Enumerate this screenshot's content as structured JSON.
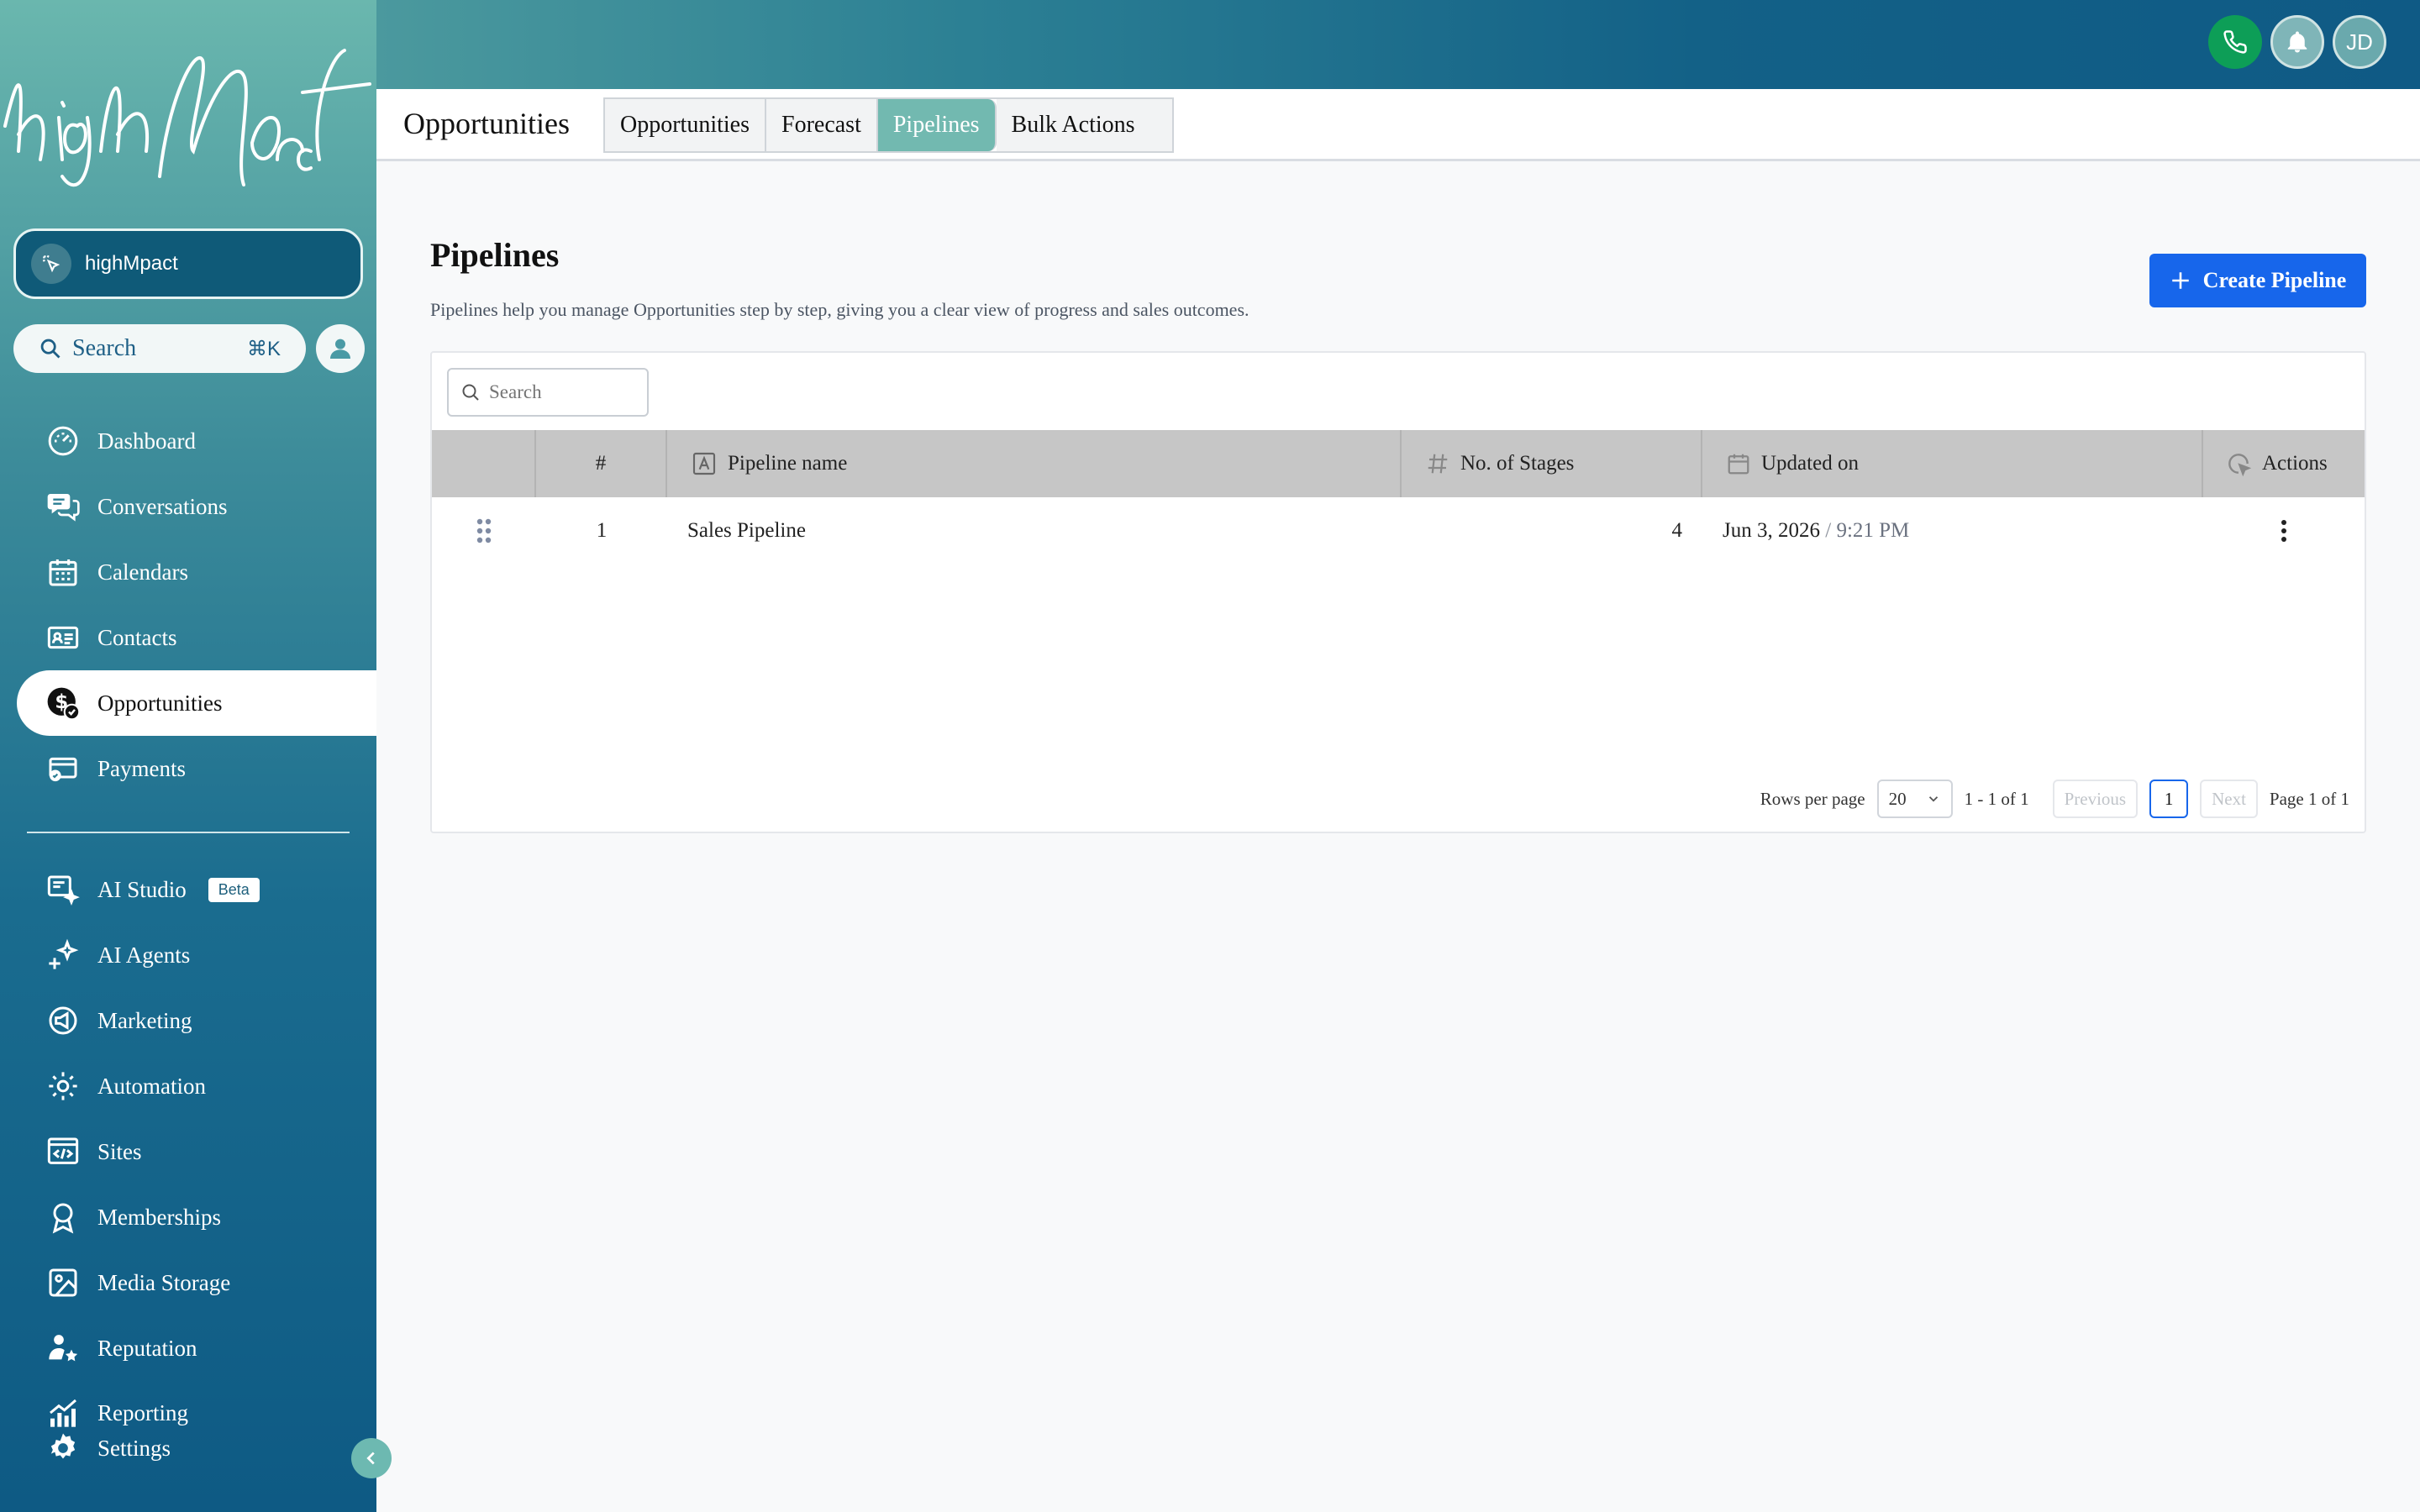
{
  "brand": {
    "logo_text": "highMpact"
  },
  "account": {
    "name": "highMpact"
  },
  "sidebar_search": {
    "label": "Search",
    "shortcut": "⌘K"
  },
  "nav_items": [
    {
      "label": "Dashboard",
      "icon": "dashboard-icon"
    },
    {
      "label": "Conversations",
      "icon": "chat-icon"
    },
    {
      "label": "Calendars",
      "icon": "calendar-icon"
    },
    {
      "label": "Contacts",
      "icon": "contacts-icon"
    },
    {
      "label": "Opportunities",
      "icon": "dollar-icon",
      "active": true
    },
    {
      "label": "Payments",
      "icon": "payment-card-icon"
    }
  ],
  "nav_items_secondary": [
    {
      "label": "AI Studio",
      "icon": "ai-studio-icon",
      "badge": "Beta"
    },
    {
      "label": "AI Agents",
      "icon": "sparkle-icon"
    },
    {
      "label": "Marketing",
      "icon": "megaphone-icon"
    },
    {
      "label": "Automation",
      "icon": "gear-cycle-icon"
    },
    {
      "label": "Sites",
      "icon": "code-window-icon"
    },
    {
      "label": "Memberships",
      "icon": "award-icon"
    },
    {
      "label": "Media Storage",
      "icon": "image-icon"
    },
    {
      "label": "Reputation",
      "icon": "star-user-icon"
    },
    {
      "label": "Reporting",
      "icon": "chart-icon"
    },
    {
      "label": "Settings",
      "icon": "settings-icon"
    }
  ],
  "header": {
    "avatar_initials": "JD"
  },
  "subheader": {
    "title": "Opportunities",
    "tabs": [
      {
        "label": "Opportunities"
      },
      {
        "label": "Forecast"
      },
      {
        "label": "Pipelines",
        "active": true
      },
      {
        "label": "Bulk Actions"
      }
    ]
  },
  "page": {
    "title": "Pipelines",
    "description": "Pipelines help you manage Opportunities step by step, giving you a clear view of progress and sales outcomes.",
    "create_label": "Create Pipeline"
  },
  "table": {
    "search_placeholder": "Search",
    "columns": {
      "index": "#",
      "name": "Pipeline name",
      "stages": "No. of Stages",
      "updated": "Updated on",
      "actions": "Actions"
    },
    "rows": [
      {
        "index": "1",
        "name": "Sales Pipeline",
        "stages": "4",
        "date": "Jun 3, 2026",
        "sep": " / ",
        "time": "9:21 PM"
      }
    ]
  },
  "pagination": {
    "rows_per_page_label": "Rows per page",
    "rows_per_page": "20",
    "range": "1 - 1 of 1",
    "previous": "Previous",
    "current_page": "1",
    "next": "Next",
    "page_info": "Page 1 of 1"
  },
  "colors": {
    "primary": "#1766eb",
    "accent": "#72b9b0",
    "sidebar_dark": "#0e5a84"
  }
}
